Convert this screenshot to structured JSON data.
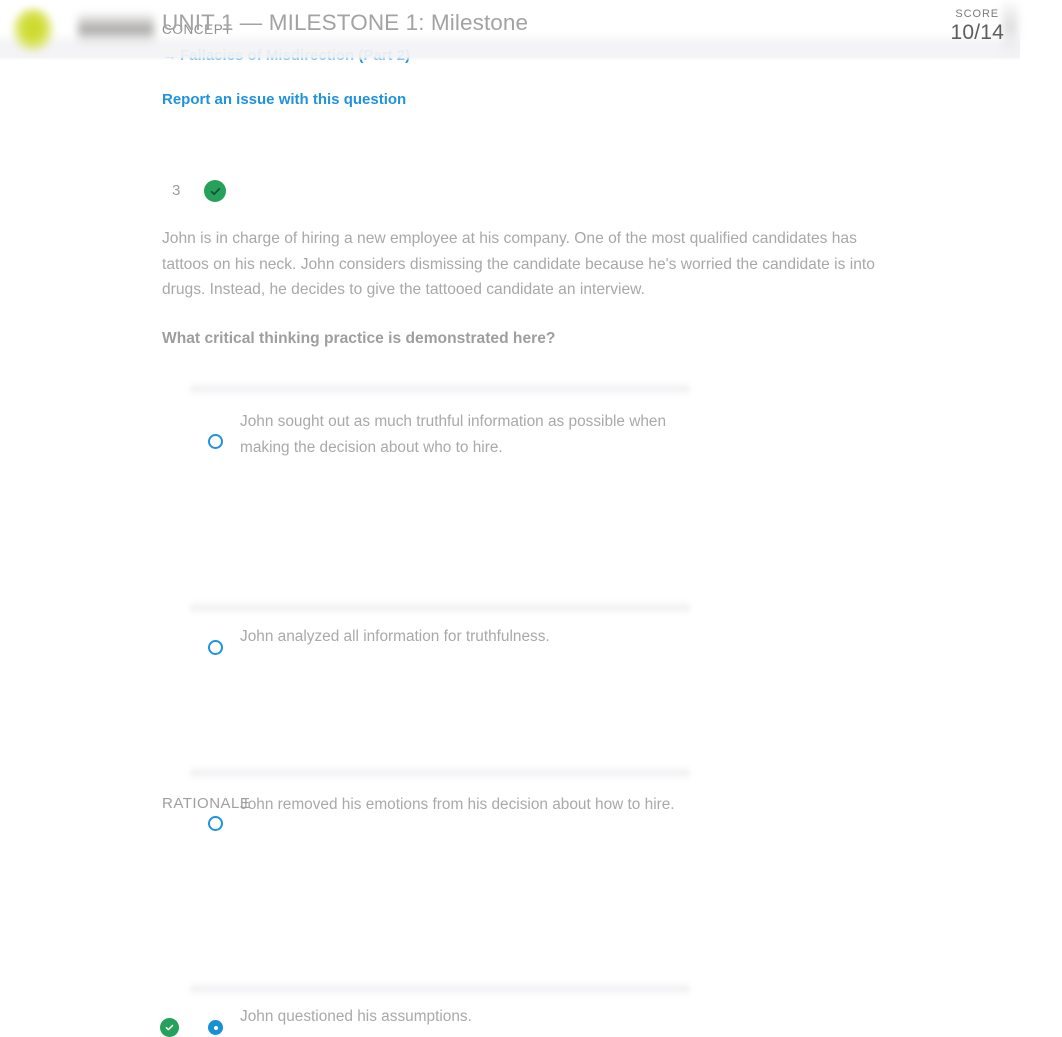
{
  "header": {
    "milestone_title": "UNIT 1 — MILESTONE 1: Milestone",
    "score_label": "SCORE",
    "score_value": "10/14",
    "logo_icon": "sophia-logo-icon",
    "wordmark_icon": "brand-wordmark-icon"
  },
  "concept": {
    "label": "CONCEPT",
    "link_arrow": "→",
    "link_text": "Fallacies of Misdirection (Part 2)"
  },
  "report": {
    "link_text": "Report an issue with this question"
  },
  "question": {
    "number": "3",
    "status_icon": "check-circle-icon",
    "body": "John is in charge of hiring a new employee at his company. One of the most qualified candidates has tattoos on his neck. John considers dismissing the candidate because he's worried the candidate is into drugs. Instead, he decides to give the tattooed candidate an interview.",
    "prompt": "What critical thinking practice is demonstrated here?"
  },
  "options": [
    {
      "text": "John sought out as much truthful information as possible when making the decision about who to hire.",
      "selected": false,
      "correct": false,
      "radio_icon": "radio-unchecked-icon"
    },
    {
      "text": "John analyzed all information for truthfulness.",
      "selected": false,
      "correct": false,
      "radio_icon": "radio-unchecked-icon"
    },
    {
      "text": "John removed his emotions from his decision about how to hire.",
      "selected": false,
      "correct": false,
      "radio_icon": "radio-unchecked-icon"
    },
    {
      "text": "John questioned his assumptions.",
      "selected": true,
      "correct": true,
      "radio_icon": "radio-checked-icon",
      "correct_icon": "check-circle-icon"
    }
  ],
  "rationale": {
    "label": "RATIONALE"
  },
  "colors": {
    "link": "#1f93dd",
    "correct_green": "#25a15c",
    "radio_blue": "#1790d8",
    "text_gray": "#a8a8a8",
    "header_bg": "#f3f3f5"
  }
}
